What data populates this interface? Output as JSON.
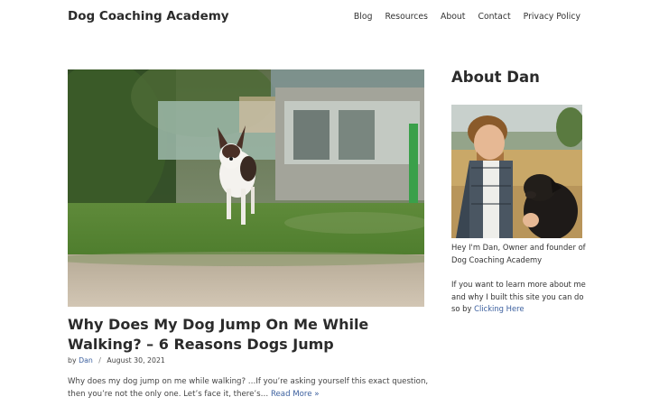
{
  "header": {
    "site_title": "Dog Coaching Academy",
    "nav": [
      "Blog",
      "Resources",
      "About",
      "Contact",
      "Privacy Policy"
    ]
  },
  "post": {
    "title": "Why Does My Dog Jump On Me While Walking? – 6 Reasons Dogs Jump",
    "meta": {
      "by": "by",
      "author": "Dan",
      "separator": "/",
      "date": "August 30, 2021"
    },
    "excerpt": "Why does my dog jump on me while walking? …If you’re asking yourself this exact question, then you’re not the only one. Let’s face it, there’s… ",
    "read_more": "Read More »"
  },
  "sidebar": {
    "title": "About Dan",
    "about": "Hey I'm Dan, Owner and founder of Dog Coaching Academy",
    "more_prefix": "If you want to learn more about me and why I built this site you can do so by ",
    "more_link": "Clicking Here"
  },
  "colors": {
    "link": "#3b5f9e",
    "text": "#2b2b2b"
  }
}
